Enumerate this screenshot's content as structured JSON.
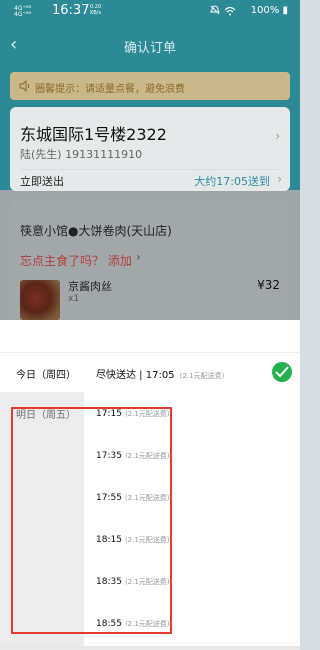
{
  "status_bar": {
    "signal_1": "4G⁺ᴴᴰ",
    "signal_2": "4G⁺ᴴᴰ",
    "time": "16:37",
    "speed_value": "0.20",
    "speed_unit": "KB/s",
    "battery": "100%"
  },
  "header": {
    "title": "确认订单"
  },
  "notice": {
    "text": "圈馨提示：请适量点餐，避免浪费"
  },
  "address": {
    "line1": "东城国际1号楼2322",
    "contact": "陆(先生) 19131111910",
    "deliver_now": "立即送出",
    "eta": "大约17:05送到"
  },
  "shop": {
    "name": "筷意小馆●大饼卷肉(天山店)",
    "upsell": "忘点主食了吗？ 添加",
    "dish_name": "京酱肉丝",
    "dish_qty": "x1",
    "dish_price": "¥32"
  },
  "time_picker": {
    "today_label": "今日（周四）",
    "today_slot": "尽快送达 | 17:05",
    "today_fee": "(2.1元配送费)",
    "tomorrow_label": "明日（周五）",
    "tomorrow_slots": [
      {
        "time": "17:15",
        "fee": "(2.1元配送费)"
      },
      {
        "time": "17:35",
        "fee": "(2.1元配送费)"
      },
      {
        "time": "17:55",
        "fee": "(2.1元配送费)"
      },
      {
        "time": "18:15",
        "fee": "(2.1元配送费)"
      },
      {
        "time": "18:35",
        "fee": "(2.1元配送费)"
      },
      {
        "time": "18:55",
        "fee": "(2.1元配送费)"
      }
    ]
  },
  "colors": {
    "header_bg": "#2c8a96",
    "accent_blue": "#2d8ea0",
    "check_green": "#22b14c",
    "highlight_red": "#e23b30"
  }
}
